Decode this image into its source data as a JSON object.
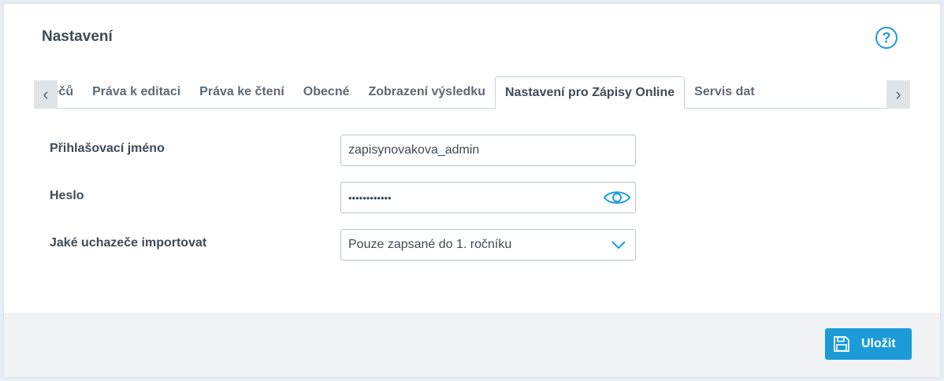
{
  "page": {
    "title": "Nastavení",
    "help_icon": "question-circle-icon"
  },
  "tabs": [
    {
      "label": "Práva pouze k editaci uchazečů"
    },
    {
      "label": "Práva k editaci"
    },
    {
      "label": "Práva ke čtení"
    },
    {
      "label": "Obecné"
    },
    {
      "label": "Zobrazení výsledku"
    },
    {
      "label": "Nastavení pro Zápisy Online",
      "active": true
    },
    {
      "label": "Servis dat"
    }
  ],
  "form": {
    "login": {
      "label": "Přihlašovací jméno",
      "value": "zapisynovakova_admin"
    },
    "password": {
      "label": "Heslo",
      "value": "••••••••••••"
    },
    "import": {
      "label": "Jaké uchazeče importovat",
      "value": "Pouze zapsané do 1. ročníku"
    }
  },
  "footer": {
    "save_label": "Uložit"
  },
  "colors": {
    "accent": "#1b9bd7",
    "text": "#3d4b57",
    "border": "#b9c4cd"
  }
}
